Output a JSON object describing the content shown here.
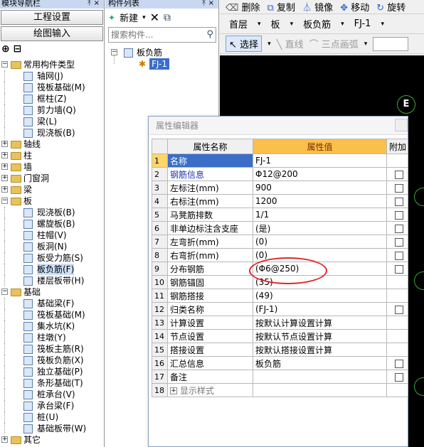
{
  "nav": {
    "title": "模块导航栏",
    "pin_glyphs": "ᛡ ×",
    "btn_project": "工程设置",
    "btn_draw": "绘图输入",
    "toolrow": "⊕ ⊟",
    "tree": [
      {
        "label": "常用构件类型",
        "level": 0,
        "expand": "−",
        "folder": true
      },
      {
        "label": "轴网(J)",
        "level": 1,
        "icon": "grid-icon"
      },
      {
        "label": "筏板基础(M)",
        "level": 1,
        "icon": "raft-foundation-icon"
      },
      {
        "label": "框柱(Z)",
        "level": 1,
        "icon": "column-icon"
      },
      {
        "label": "剪力墙(Q)",
        "level": 1,
        "icon": "shear-wall-icon"
      },
      {
        "label": "梁(L)",
        "level": 1,
        "icon": "beam-icon"
      },
      {
        "label": "现浇板(B)",
        "level": 1,
        "icon": "slab-icon"
      },
      {
        "label": "轴线",
        "level": 0,
        "expand": "+",
        "folder": true
      },
      {
        "label": "柱",
        "level": 0,
        "expand": "+",
        "folder": true
      },
      {
        "label": "墙",
        "level": 0,
        "expand": "+",
        "folder": true
      },
      {
        "label": "门窗洞",
        "level": 0,
        "expand": "+",
        "folder": true
      },
      {
        "label": "梁",
        "level": 0,
        "expand": "+",
        "folder": true
      },
      {
        "label": "板",
        "level": 0,
        "expand": "−",
        "folder": true
      },
      {
        "label": "现浇板(B)",
        "level": 1,
        "icon": "slab-icon"
      },
      {
        "label": "螺旋板(B)",
        "level": 1,
        "icon": "spiral-slab-icon"
      },
      {
        "label": "柱帽(V)",
        "level": 1,
        "icon": "column-cap-icon"
      },
      {
        "label": "板洞(N)",
        "level": 1,
        "icon": "slab-hole-icon"
      },
      {
        "label": "板受力筋(S)",
        "level": 1,
        "icon": "slab-rebar-icon"
      },
      {
        "label": "板负筋(F)",
        "level": 1,
        "icon": "negative-rebar-icon",
        "selected": true
      },
      {
        "label": "楼层板带(H)",
        "level": 1,
        "icon": "floor-strip-icon"
      },
      {
        "label": "基础",
        "level": 0,
        "expand": "−",
        "folder": true
      },
      {
        "label": "基础梁(F)",
        "level": 1,
        "icon": "foundation-beam-icon"
      },
      {
        "label": "筏板基础(M)",
        "level": 1,
        "icon": "raft-foundation-icon"
      },
      {
        "label": "集水坑(K)",
        "level": 1,
        "icon": "sump-pit-icon"
      },
      {
        "label": "柱墩(Y)",
        "level": 1,
        "icon": "column-pier-icon"
      },
      {
        "label": "筏板主筋(R)",
        "level": 1,
        "icon": "raft-main-rebar-icon"
      },
      {
        "label": "筏板负筋(X)",
        "level": 1,
        "icon": "raft-negative-rebar-icon"
      },
      {
        "label": "独立基础(P)",
        "level": 1,
        "icon": "isolated-footing-icon"
      },
      {
        "label": "条形基础(T)",
        "level": 1,
        "icon": "strip-footing-icon"
      },
      {
        "label": "桩承台(V)",
        "level": 1,
        "icon": "pile-cap-icon"
      },
      {
        "label": "承台梁(F)",
        "level": 1,
        "icon": "cap-beam-icon"
      },
      {
        "label": "桩(U)",
        "level": 1,
        "icon": "pile-icon"
      },
      {
        "label": "基础板带(W)",
        "level": 1,
        "icon": "foundation-strip-icon"
      },
      {
        "label": "其它",
        "level": 0,
        "expand": "+",
        "folder": true
      }
    ]
  },
  "comp": {
    "title": "构件列表",
    "new_label": "新建",
    "delete_glyph": "✕",
    "copy_glyph": "⧉",
    "search_placeholder": "搜索构件...",
    "tree_root": "板负筋",
    "tree_item": "FJ-1"
  },
  "work": {
    "tb1": {
      "delete": "删除",
      "copy": "复制",
      "mirror": "镜像",
      "move": "移动",
      "rotate": "旋转"
    },
    "floor": "首层",
    "category": "板",
    "type": "板负筋",
    "item": "FJ-1",
    "select": "选择",
    "line": "直线",
    "arc": "三点画弧",
    "axis_label": "E"
  },
  "dialog": {
    "title": "属性编辑器",
    "col_name": "属性名称",
    "col_value": "属性值",
    "col_extra": "附加",
    "rows": [
      {
        "n": "1",
        "name": "名称",
        "value": "FJ-1",
        "check": false,
        "selected": true
      },
      {
        "n": "2",
        "name": "钢筋信息",
        "value": "Φ12@200",
        "check": true,
        "blue": true
      },
      {
        "n": "3",
        "name": "左标注(mm)",
        "value": "900",
        "check": true
      },
      {
        "n": "4",
        "name": "右标注(mm)",
        "value": "1200",
        "check": true
      },
      {
        "n": "5",
        "name": "马凳筋排数",
        "value": "1/1",
        "check": true
      },
      {
        "n": "6",
        "name": "非单边标注含支座",
        "value": "(是)",
        "check": true
      },
      {
        "n": "7",
        "name": "左弯折(mm)",
        "value": "(0)",
        "check": true
      },
      {
        "n": "8",
        "name": "右弯折(mm)",
        "value": "(0)",
        "check": true
      },
      {
        "n": "9",
        "name": "分布钢筋",
        "value": "(Φ6@250)",
        "check": true
      },
      {
        "n": "10",
        "name": "钢筋锚固",
        "value": "(35)",
        "check": false
      },
      {
        "n": "11",
        "name": "钢筋搭接",
        "value": "(49)",
        "check": false
      },
      {
        "n": "12",
        "name": "归类名称",
        "value": "(FJ-1)",
        "check": true
      },
      {
        "n": "13",
        "name": "计算设置",
        "value": "按默认计算设置计算",
        "check": false
      },
      {
        "n": "14",
        "name": "节点设置",
        "value": "按默认节点设置计算",
        "check": false
      },
      {
        "n": "15",
        "name": "搭接设置",
        "value": "按默认搭接设置计算",
        "check": false
      },
      {
        "n": "16",
        "name": "汇总信息",
        "value": "板负筋",
        "check": true
      },
      {
        "n": "17",
        "name": "备注",
        "value": "",
        "check": true
      },
      {
        "n": "18",
        "name": "显示样式",
        "value": "",
        "check": false,
        "group": true
      }
    ]
  },
  "colors": {
    "accent": "#3a6ec8",
    "value_header": "#fbc04a",
    "highlight_circle": "#e0262a",
    "canvas": "#000000",
    "axis_marker": "#3ca83c"
  }
}
